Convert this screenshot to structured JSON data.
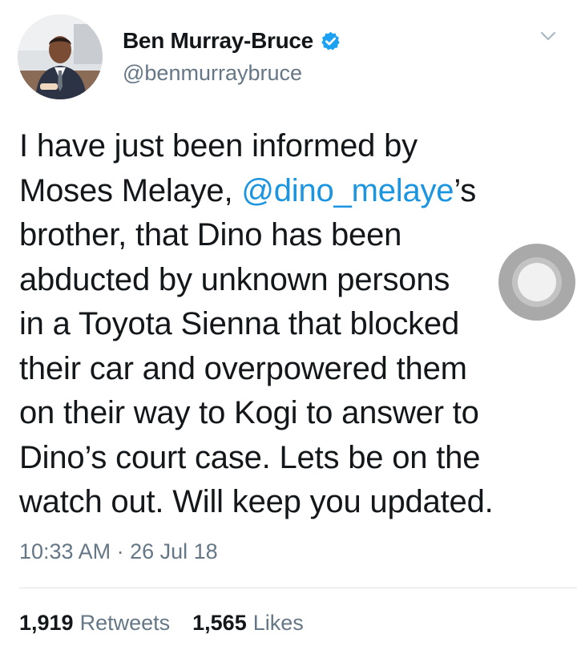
{
  "tweet": {
    "author": {
      "display_name": "Ben Murray-Bruce",
      "handle": "@benmurraybruce",
      "verified": true,
      "avatar_icon": "profile-photo"
    },
    "text_lines": [
      {
        "before": "I have just been informed by",
        "mention": "",
        "after": ""
      },
      {
        "before": "Moses Melaye, ",
        "mention": "@dino_melaye",
        "after": "’s"
      },
      {
        "before": "brother, that Dino has been",
        "mention": "",
        "after": ""
      },
      {
        "before": "abducted by unknown persons",
        "mention": "",
        "after": ""
      },
      {
        "before": "in a Toyota Sienna that blocked",
        "mention": "",
        "after": ""
      },
      {
        "before": "their car and overpowered them",
        "mention": "",
        "after": ""
      },
      {
        "before": "on their way to Kogi to answer to",
        "mention": "",
        "after": ""
      },
      {
        "before": "Dino’s court case. Lets be on the",
        "mention": "",
        "after": ""
      },
      {
        "before": "watch out. Will keep you updated.",
        "mention": "",
        "after": ""
      }
    ],
    "timestamp": "10:33 AM · 26 Jul 18",
    "stats": {
      "retweets_count": "1,919",
      "retweets_label": "Retweets",
      "likes_count": "1,565",
      "likes_label": "Likes"
    }
  },
  "colors": {
    "text": "#14171a",
    "secondary": "#657786",
    "mention": "#1b95e0",
    "verified_badge": "#1da1f2",
    "divider": "#dfe3e7"
  },
  "icons": {
    "more": "chevron-down-icon",
    "verified": "verified-badge-icon",
    "overlay": "assistive-touch-button"
  }
}
